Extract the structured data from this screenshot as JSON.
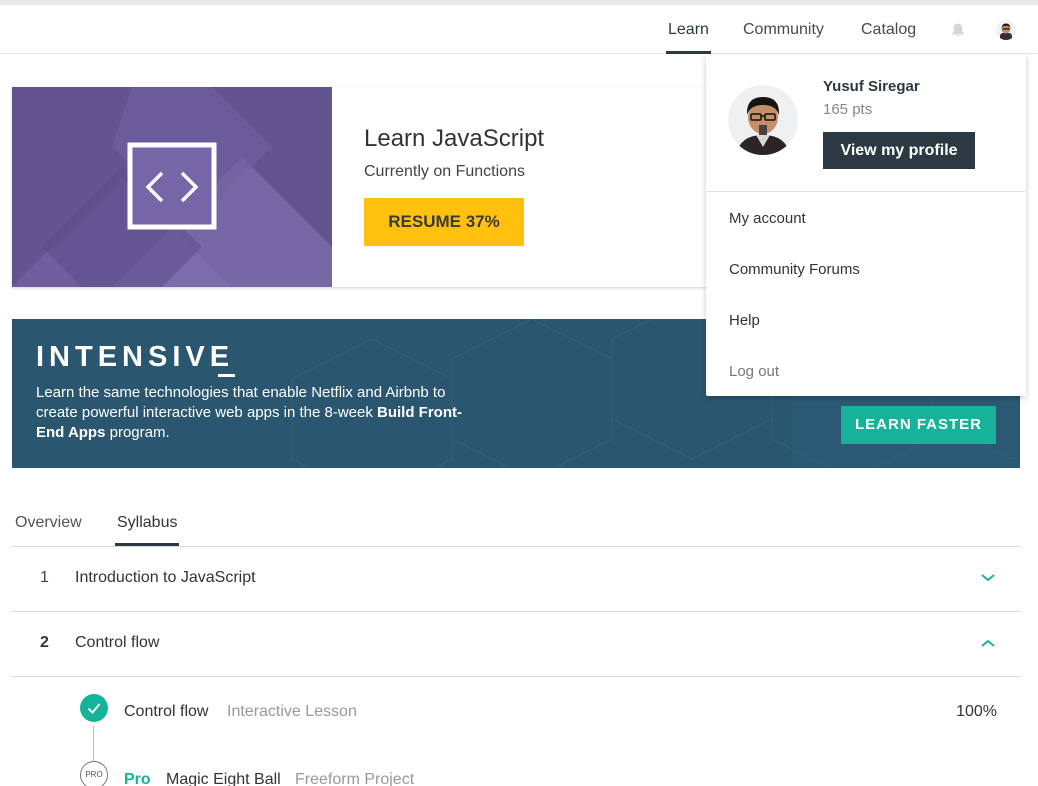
{
  "nav": {
    "learn": "Learn",
    "community": "Community",
    "catalog": "Catalog"
  },
  "course": {
    "title": "Learn JavaScript",
    "subtitle": "Currently on Functions",
    "resume_label": "RESUME 37%",
    "progress_percent": 37
  },
  "banner": {
    "title": "INTENSIVE",
    "text_prefix": "Learn the same technologies that enable Netflix and Airbnb to create powerful interactive web apps in the 8-week ",
    "text_bold": "Build Front-End Apps",
    "text_suffix": " program.",
    "cta": "LEARN FASTER"
  },
  "tabs": [
    {
      "label": "Overview"
    },
    {
      "label": "Syllabus"
    }
  ],
  "syllabus": [
    {
      "num": "1",
      "title": "Introduction to JavaScript",
      "state": "collapsed"
    },
    {
      "num": "2",
      "title": "Control flow",
      "state": "expanded"
    }
  ],
  "lessons": [
    {
      "name": "Control flow",
      "type": "Interactive Lesson",
      "percent": "100%"
    },
    {
      "badge": "PRO",
      "tag": "Pro",
      "name": "Magic Eight Ball",
      "type": "Freeform Project"
    }
  ],
  "dropdown": {
    "name": "Yusuf Siregar",
    "points": "165 pts",
    "view_profile": "View my profile",
    "items": [
      "My account",
      "Community Forums",
      "Help",
      "Log out"
    ]
  },
  "colors": {
    "accent_yellow": "#ffc10e",
    "accent_teal": "#16b39a",
    "dark_navy": "#2b3a42",
    "banner_blue": "#2b5872",
    "course_purple": "#6b5d9c"
  },
  "icons": {
    "bell": "bell-icon",
    "code": "code-brackets-icon",
    "chevron_down": "chevron-down-icon",
    "chevron_up": "chevron-up-icon",
    "check": "check-icon"
  }
}
